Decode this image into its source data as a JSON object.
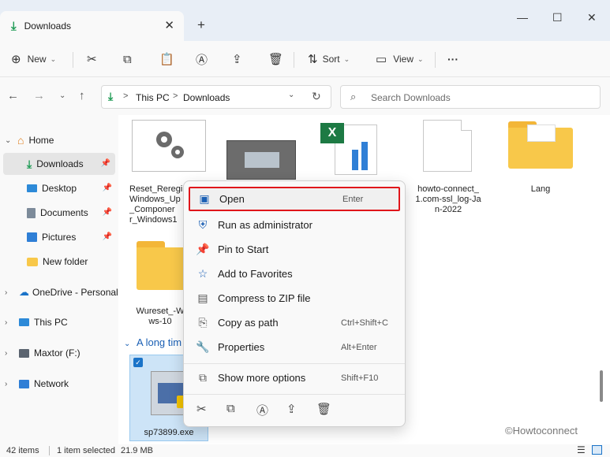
{
  "window": {
    "tab_title": "Downloads",
    "tab_close": "✕",
    "new_tab": "+",
    "minimize": "—",
    "maximize": "☐",
    "close": "✕"
  },
  "toolbar": {
    "new_label": "New",
    "sort_label": "Sort",
    "view_label": "View",
    "more_label": "···"
  },
  "address": {
    "crumbs": [
      "This PC",
      "Downloads"
    ],
    "separator": ">",
    "search_placeholder": "Search Downloads"
  },
  "sidebar": {
    "items": [
      {
        "label": "Home"
      },
      {
        "label": "Downloads"
      },
      {
        "label": "Desktop"
      },
      {
        "label": "Documents"
      },
      {
        "label": "Pictures"
      },
      {
        "label": "New folder"
      },
      {
        "label": "OneDrive - Personal"
      },
      {
        "label": "This PC"
      },
      {
        "label": "Maxtor (F:)"
      },
      {
        "label": "Network"
      }
    ]
  },
  "files": {
    "reset_name_lines": [
      "Reset_Reregi",
      "Windows_Up",
      "_Componer",
      "r_Windows1"
    ],
    "howto_name_lines": [
      "howto-connect_",
      "1.com-ssl_log-Ja",
      "n-2022"
    ],
    "lang_name": "Lang",
    "wureset_lines": [
      "Wureset_-W",
      "ws-10"
    ],
    "group_label": "A long tim",
    "sp_name": "sp73899.exe"
  },
  "context_menu": {
    "items": [
      {
        "label": "Open",
        "shortcut": "Enter"
      },
      {
        "label": "Run as administrator",
        "shortcut": ""
      },
      {
        "label": "Pin to Start",
        "shortcut": ""
      },
      {
        "label": "Add to Favorites",
        "shortcut": ""
      },
      {
        "label": "Compress to ZIP file",
        "shortcut": ""
      },
      {
        "label": "Copy as path",
        "shortcut": "Ctrl+Shift+C"
      },
      {
        "label": "Properties",
        "shortcut": "Alt+Enter"
      },
      {
        "label": "Show more options",
        "shortcut": "Shift+F10"
      }
    ]
  },
  "status": {
    "items_count": "42 items",
    "selection": "1 item selected",
    "size": "21.9 MB"
  },
  "watermark": "©Howtoconnect",
  "colors": {
    "accent": "#1a73c8",
    "highlight_border": "#e0161b",
    "folder": "#f8c84a"
  }
}
